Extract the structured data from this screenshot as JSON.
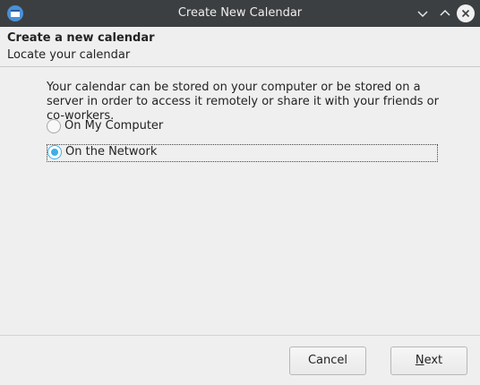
{
  "window": {
    "title": "Create New Calendar",
    "icon": "calendar-app-icon"
  },
  "titlebar_buttons": {
    "minimize_icon": "chevron-down-icon",
    "maximize_icon": "chevron-up-icon",
    "close_icon": "close-icon"
  },
  "header": {
    "title": "Create a new calendar",
    "subtitle": "Locate your calendar"
  },
  "body": {
    "description": "Your calendar can be stored on your computer or be stored on a server in order to access it remotely or share it with your friends or co-workers."
  },
  "options": [
    {
      "label": "On My Computer",
      "selected": false
    },
    {
      "label": "On the Network",
      "selected": true
    }
  ],
  "footer": {
    "cancel_label": "Cancel",
    "next_label_first": "N",
    "next_label_rest": "ext"
  },
  "colors": {
    "accent": "#3daee9",
    "titlebar": "#3c3f41",
    "background": "#efefef"
  }
}
